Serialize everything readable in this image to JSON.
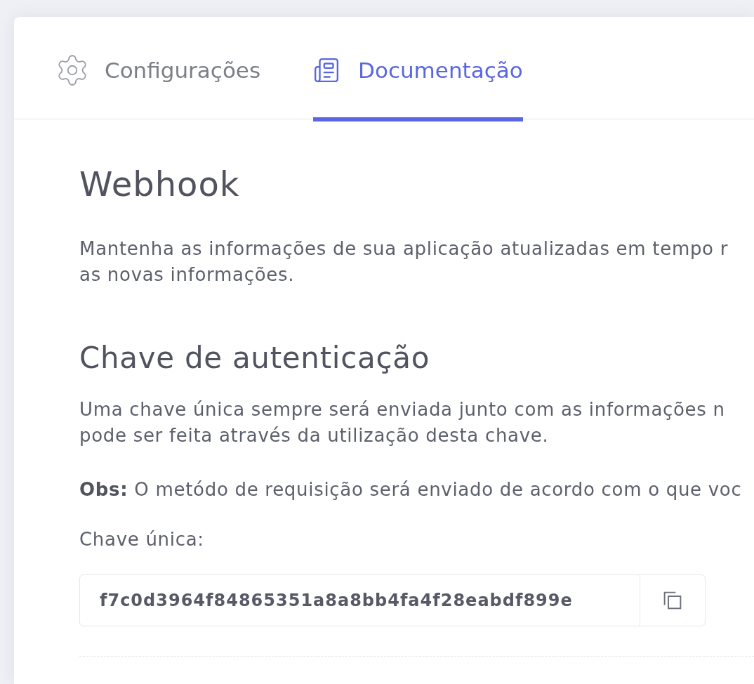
{
  "tabs": [
    {
      "kind": "settings",
      "label": "Configurações",
      "selected": false
    },
    {
      "kind": "docs",
      "label": "Documentação",
      "selected": true
    }
  ],
  "webhook": {
    "title": "Webhook",
    "description": [
      "Mantenha as informações de sua aplicação atualizadas em tempo r",
      "as novas informações."
    ]
  },
  "authentication": {
    "title": "Chave de autenticação",
    "description": [
      "Uma chave única sempre será enviada junto com as informações n",
      "pode ser feita através da utilização desta chave."
    ],
    "note": "**Obs:** O metódo de requisição será enviado de acordo com o que voc",
    "key_label": "Chave única:",
    "key_field": {
      "value": "f7c0d3964f84865351a8a8bb4fa4f28eabdf899e"
    }
  }
}
